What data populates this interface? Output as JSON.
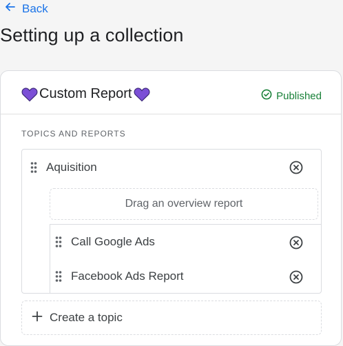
{
  "nav": {
    "back_label": "Back"
  },
  "page": {
    "title": "Setting up a collection"
  },
  "report": {
    "title": "Custom Report",
    "status": "Published",
    "heart_color": "#7b4fd6",
    "status_color": "#188038"
  },
  "section": {
    "label": "TOPICS AND REPORTS"
  },
  "topic": {
    "name": "Aquisition",
    "dropzone_text": "Drag an overview report",
    "reports": [
      {
        "label": "Call Google Ads"
      },
      {
        "label": "Facebook Ads Report"
      }
    ]
  },
  "actions": {
    "create_topic_label": "Create a topic"
  }
}
